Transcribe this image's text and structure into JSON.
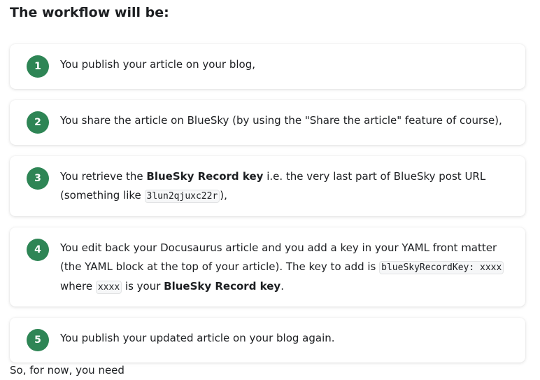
{
  "heading": "The workflow will be:",
  "steps": [
    {
      "number": "1",
      "text": "You publish your article on your blog,"
    },
    {
      "number": "2",
      "text": "You share the article on BlueSky (by using the \"Share the article\" feature of course),"
    },
    {
      "number": "3",
      "t1": "You retrieve the ",
      "b1": "BlueSky Record key",
      "t2": " i.e. the very last part of BlueSky post URL (something like ",
      "c1": "3lun2qjuxc22r",
      "t3": "),"
    },
    {
      "number": "4",
      "t1": "You edit back your Docusaurus article and you add a key in your YAML front matter (the YAML block at the top of your article). The key to add is ",
      "c1": "blueSkyRecordKey: xxxx",
      "t2": " where ",
      "c2": "xxxx",
      "t3": " is your ",
      "b1": "BlueSky Record key",
      "t4": "."
    },
    {
      "number": "5",
      "text": "You publish your updated article on your blog again."
    }
  ],
  "footer_partial": "So, for now, you need",
  "colors": {
    "step_badge": "#2e8555",
    "text": "#1c1e21",
    "code_bg": "#f6f7f8"
  }
}
